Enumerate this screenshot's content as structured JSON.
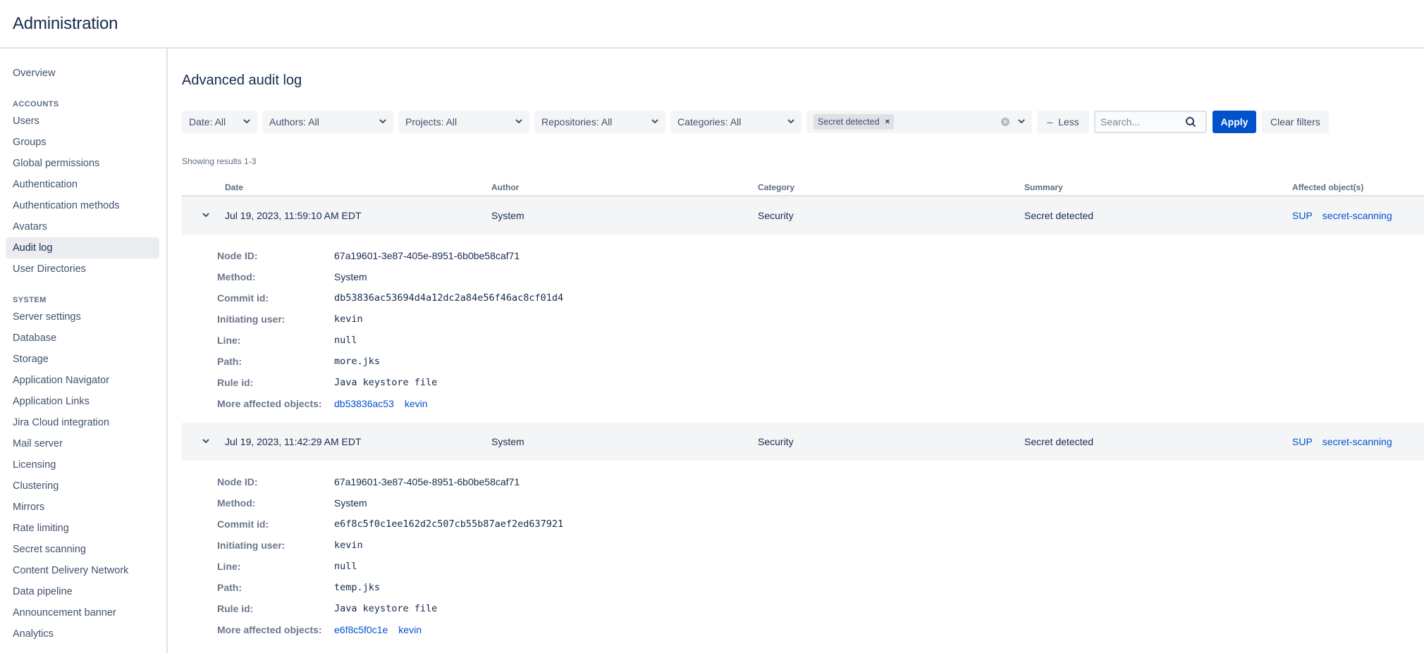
{
  "header": {
    "title": "Administration"
  },
  "sidebar": {
    "top_items": [
      {
        "label": "Overview"
      }
    ],
    "sections": [
      {
        "title": "ACCOUNTS",
        "items": [
          {
            "label": "Users"
          },
          {
            "label": "Groups"
          },
          {
            "label": "Global permissions"
          },
          {
            "label": "Authentication"
          },
          {
            "label": "Authentication methods"
          },
          {
            "label": "Avatars"
          },
          {
            "label": "Audit log",
            "active": true
          },
          {
            "label": "User Directories"
          }
        ]
      },
      {
        "title": "SYSTEM",
        "items": [
          {
            "label": "Server settings"
          },
          {
            "label": "Database"
          },
          {
            "label": "Storage"
          },
          {
            "label": "Application Navigator"
          },
          {
            "label": "Application Links"
          },
          {
            "label": "Jira Cloud integration"
          },
          {
            "label": "Mail server"
          },
          {
            "label": "Licensing"
          },
          {
            "label": "Clustering"
          },
          {
            "label": "Mirrors"
          },
          {
            "label": "Rate limiting"
          },
          {
            "label": "Secret scanning"
          },
          {
            "label": "Content Delivery Network"
          },
          {
            "label": "Data pipeline"
          },
          {
            "label": "Announcement banner"
          },
          {
            "label": "Analytics"
          }
        ]
      }
    ]
  },
  "main": {
    "title": "Advanced audit log",
    "filters": {
      "date": "Date: All",
      "authors": "Authors: All",
      "projects": "Projects: All",
      "repositories": "Repositories: All",
      "categories": "Categories: All",
      "summary_tag": "Secret detected",
      "tag_remove_icon": "×",
      "less_label": "Less",
      "search_placeholder": "Search...",
      "search_value": "",
      "apply_label": "Apply",
      "clear_label": "Clear filters"
    },
    "results_text": "Showing results 1-3",
    "table": {
      "columns": [
        "Date",
        "Author",
        "Category",
        "Summary",
        "Affected object(s)"
      ],
      "detail_labels": {
        "node_id": "Node ID:",
        "method": "Method:",
        "commit_id": "Commit id:",
        "initiating_user": "Initiating user:",
        "line": "Line:",
        "path": "Path:",
        "rule_id": "Rule id:",
        "more_affected": "More affected objects:"
      },
      "rows": [
        {
          "date": "Jul 19, 2023, 11:59:10 AM EDT",
          "author": "System",
          "category": "Security",
          "summary": "Secret detected",
          "affected": [
            "SUP",
            "secret-scanning"
          ],
          "expanded": true,
          "details": {
            "node_id": "67a19601-3e87-405e-8951-6b0be58caf71",
            "method": "System",
            "commit_id": "db53836ac53694d4a12dc2a84e56f46ac8cf01d4",
            "initiating_user": "kevin",
            "line": "null",
            "path": "more.jks",
            "rule_id": "Java keystore file",
            "more_affected": [
              "db53836ac53",
              "kevin"
            ]
          }
        },
        {
          "date": "Jul 19, 2023, 11:42:29 AM EDT",
          "author": "System",
          "category": "Security",
          "summary": "Secret detected",
          "affected": [
            "SUP",
            "secret-scanning"
          ],
          "expanded": true,
          "details": {
            "node_id": "67a19601-3e87-405e-8951-6b0be58caf71",
            "method": "System",
            "commit_id": "e6f8c5f0c1ee162d2c507cb55b87aef2ed637921",
            "initiating_user": "kevin",
            "line": "null",
            "path": "temp.jks",
            "rule_id": "Java keystore file",
            "more_affected": [
              "e6f8c5f0c1e",
              "kevin"
            ]
          }
        }
      ]
    }
  },
  "colors": {
    "accent": "#0052cc",
    "text": "#172b4d",
    "row_bg": "#f4f5f7"
  }
}
